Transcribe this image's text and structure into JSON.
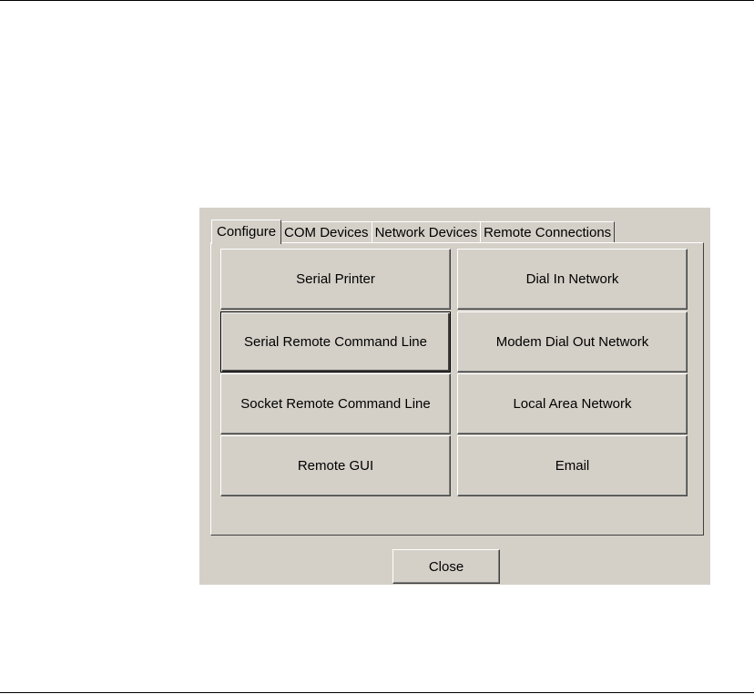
{
  "tabs": [
    {
      "label": "Configure",
      "active": true
    },
    {
      "label": "COM Devices",
      "active": false
    },
    {
      "label": "Network Devices",
      "active": false
    },
    {
      "label": "Remote Connections",
      "active": false
    }
  ],
  "configure": {
    "buttons": [
      {
        "label": "Serial Printer"
      },
      {
        "label": "Dial In Network"
      },
      {
        "label": "Serial Remote Command Line",
        "focused": true
      },
      {
        "label": "Modem Dial Out Network"
      },
      {
        "label": "Socket Remote Command Line"
      },
      {
        "label": "Local Area Network"
      },
      {
        "label": "Remote GUI"
      },
      {
        "label": "Email"
      }
    ]
  },
  "footer": {
    "close_label": "Close"
  },
  "colors": {
    "dialog_bg": "#d4d0c8",
    "highlight": "#ffffff",
    "shadow": "#404040"
  }
}
